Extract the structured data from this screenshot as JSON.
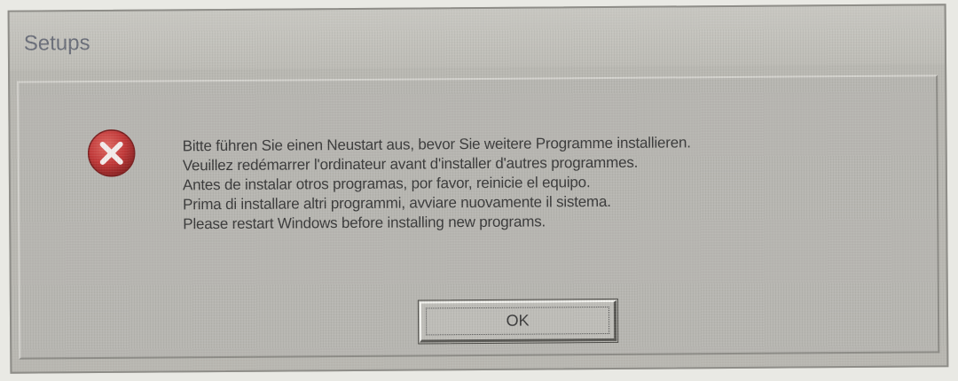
{
  "window": {
    "title": "Setups"
  },
  "message": {
    "icon": "error-icon",
    "lines": [
      "Bitte führen Sie einen Neustart aus, bevor Sie weitere Programme installieren.",
      "Veuillez redémarrer l'ordinateur avant d'installer d'autres programmes.",
      "Antes de instalar otros programas, por favor, reinicie el equipo.",
      "Prima di installare altri programmi, avviare nuovamente il sistema.",
      "Please restart Windows before installing new programs."
    ]
  },
  "buttons": {
    "ok_label": "OK"
  },
  "colors": {
    "dialog_bg": "#b9b8b2",
    "error_red": "#c23a3a",
    "title_text": "#6b6f7a"
  }
}
